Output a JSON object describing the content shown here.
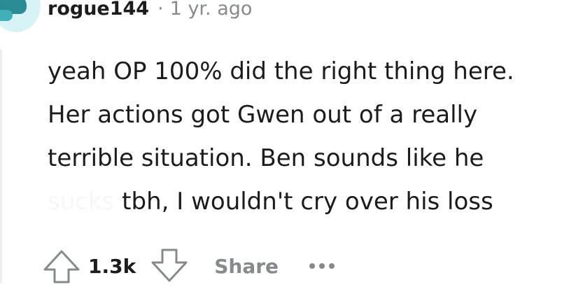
{
  "comment": {
    "author": "rogue144",
    "separator": "·",
    "age": "1 yr. ago",
    "lines": [
      "yeah OP 100% did the right thing here.",
      "Her actions got Gwen out of a really",
      "terrible situation. Ben sounds like he"
    ],
    "spoiler_text": "sucks",
    "last_line_rest": " tbh, I wouldn't cry over his loss"
  },
  "actions": {
    "vote_count": "1.3k",
    "share_label": "Share"
  },
  "icons": {
    "upvote": "upvote-arrow-icon",
    "downvote": "downvote-arrow-icon",
    "more": "more-options-icon"
  },
  "colors": {
    "text": "#1c1c1c",
    "muted": "#878a8c",
    "avatar_bg": "#d7f3f6",
    "avatar_accent": "#2a8c93"
  }
}
